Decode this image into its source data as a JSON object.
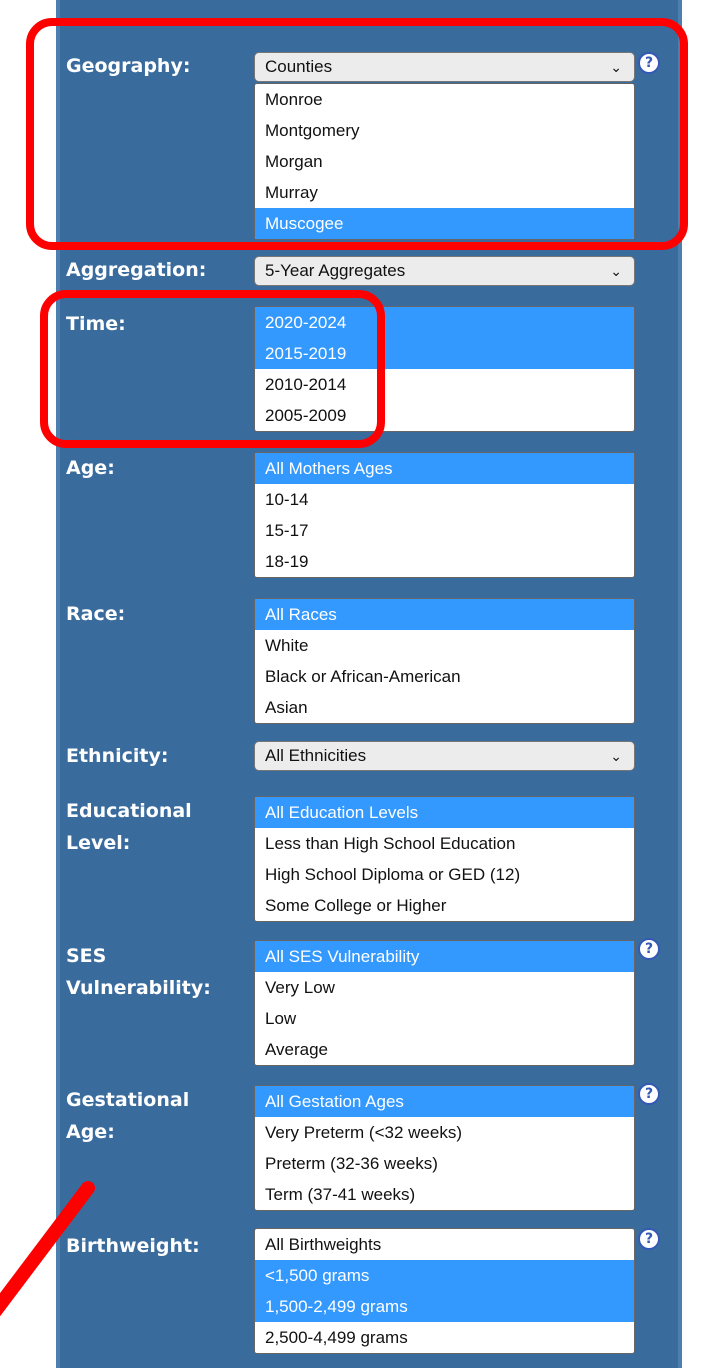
{
  "geography": {
    "label": "Geography:",
    "selected": "Counties",
    "options": [
      {
        "text": "Monroe",
        "selected": false
      },
      {
        "text": "Montgomery",
        "selected": false
      },
      {
        "text": "Morgan",
        "selected": false
      },
      {
        "text": "Murray",
        "selected": false
      },
      {
        "text": "Muscogee",
        "selected": true
      }
    ]
  },
  "aggregation": {
    "label": "Aggregation:",
    "selected": "5-Year Aggregates"
  },
  "time": {
    "label": "Time:",
    "options": [
      {
        "text": "2020-2024",
        "selected": true
      },
      {
        "text": "2015-2019",
        "selected": true
      },
      {
        "text": "2010-2014",
        "selected": false
      },
      {
        "text": "2005-2009",
        "selected": false
      }
    ]
  },
  "age": {
    "label": "Age:",
    "options": [
      {
        "text": "All Mothers Ages",
        "selected": true
      },
      {
        "text": "10-14",
        "selected": false
      },
      {
        "text": "15-17",
        "selected": false
      },
      {
        "text": "18-19",
        "selected": false
      }
    ]
  },
  "race": {
    "label": "Race:",
    "options": [
      {
        "text": "All Races",
        "selected": true
      },
      {
        "text": "White",
        "selected": false
      },
      {
        "text": "Black or African-American",
        "selected": false
      },
      {
        "text": "Asian",
        "selected": false
      }
    ]
  },
  "ethnicity": {
    "label": "Ethnicity:",
    "selected": "All Ethnicities"
  },
  "education": {
    "label_line1": "Educational",
    "label_line2": "Level:",
    "options": [
      {
        "text": "All Education Levels",
        "selected": true
      },
      {
        "text": "Less than High School Education",
        "selected": false
      },
      {
        "text": "High School Diploma or GED (12)",
        "selected": false
      },
      {
        "text": "Some College or Higher",
        "selected": false
      }
    ]
  },
  "ses": {
    "label_line1": "SES",
    "label_line2": "Vulnerability:",
    "options": [
      {
        "text": "All SES Vulnerability",
        "selected": true
      },
      {
        "text": "Very Low",
        "selected": false
      },
      {
        "text": "Low",
        "selected": false
      },
      {
        "text": "Average",
        "selected": false
      }
    ]
  },
  "gestational": {
    "label_line1": "Gestational",
    "label_line2": "Age:",
    "options": [
      {
        "text": "All Gestation Ages",
        "selected": true
      },
      {
        "text": "Very Preterm (<32 weeks)",
        "selected": false
      },
      {
        "text": "Preterm (32-36 weeks)",
        "selected": false
      },
      {
        "text": "Term (37-41 weeks)",
        "selected": false
      }
    ]
  },
  "birthweight": {
    "label": "Birthweight:",
    "options": [
      {
        "text": "All Birthweights",
        "selected": false
      },
      {
        "text": "<1,500 grams",
        "selected": true
      },
      {
        "text": "1,500-2,499 grams",
        "selected": true
      },
      {
        "text": "2,500-4,499 grams",
        "selected": false
      }
    ]
  },
  "help_icon": "?",
  "colors": {
    "panel": "#3a6b9d",
    "selection": "#3399ff",
    "highlight": "#ff0000"
  }
}
